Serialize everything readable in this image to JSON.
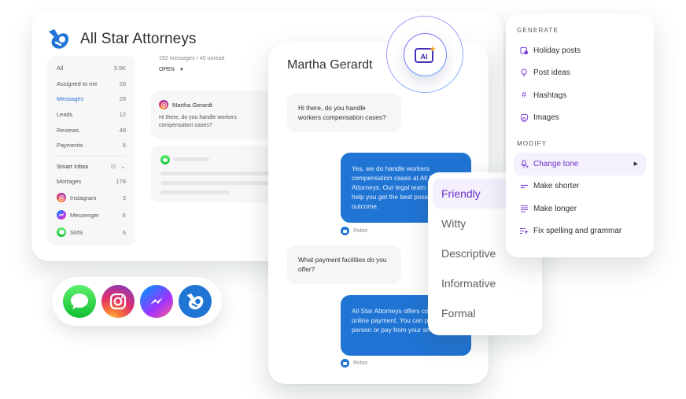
{
  "app": {
    "title": "All Star Attorneys",
    "brand_color": "#1f74d4",
    "accent_color": "#6a33c8"
  },
  "sidebar": {
    "items": [
      {
        "label": "All",
        "count": "3.5K",
        "active": false
      },
      {
        "label": "Assigned to me",
        "count": "28",
        "active": false
      },
      {
        "label": "Messages",
        "count": "28",
        "active": true
      },
      {
        "label": "Leads",
        "count": "12",
        "active": false
      },
      {
        "label": "Reviews",
        "count": "48",
        "active": false
      },
      {
        "label": "Payments",
        "count": "6",
        "active": false
      }
    ],
    "smart_inbox": {
      "label": "Smart Inbox",
      "items": [
        {
          "label": "Mortages",
          "count": "178",
          "icon": "none"
        },
        {
          "label": "Instagram",
          "count": "3",
          "icon": "instagram-icon"
        },
        {
          "label": "Messenger",
          "count": "6",
          "icon": "messenger-icon"
        },
        {
          "label": "SMS",
          "count": "6",
          "icon": "sms-icon"
        }
      ]
    }
  },
  "inbox": {
    "meta": "192 messages • 45 unread",
    "filter": "OPEN",
    "filter_caret": "▼",
    "conversations": [
      {
        "name": "Martha Gerardt",
        "channel": "instagram",
        "preview": "Hi there, do you handle workers compensation cases?"
      }
    ]
  },
  "chat": {
    "contact_name": "Martha Gerardt",
    "messages": [
      {
        "direction": "in",
        "text": "Hi there, do you handle workers compensation cases?"
      },
      {
        "direction": "out",
        "text": "Yes, we do handle workers compensation cases at All Star Attorneys. Our legal team is eager to help you get the best possible outcome.",
        "author": "Robin"
      },
      {
        "direction": "in",
        "text": "What payment facilities do you offer?"
      },
      {
        "direction": "out",
        "text": "All Star Attorneys offers convenient online payment. You can pay in person or pay from your smartphone.",
        "author": "Robin"
      }
    ]
  },
  "ai_badge": {
    "label": "AI"
  },
  "tone_menu": {
    "items": [
      {
        "label": "Friendly",
        "selected": true
      },
      {
        "label": "Witty",
        "selected": false
      },
      {
        "label": "Descriptive",
        "selected": false
      },
      {
        "label": "Informative",
        "selected": false
      },
      {
        "label": "Formal",
        "selected": false
      }
    ]
  },
  "ai_menu": {
    "generate_heading": "GENERATE",
    "generate_items": [
      {
        "label": "Holiday posts",
        "icon": "calendar-icon"
      },
      {
        "label": "Post ideas",
        "icon": "lightbulb-icon"
      },
      {
        "label": "Hashtags",
        "icon": "hashtag-icon"
      },
      {
        "label": "Images",
        "icon": "image-icon"
      }
    ],
    "modify_heading": "MODIFY",
    "modify_items": [
      {
        "label": "Change tone",
        "icon": "tone-icon",
        "active": true,
        "has_submenu": true
      },
      {
        "label": "Make shorter",
        "icon": "short-lines-icon"
      },
      {
        "label": "Make longer",
        "icon": "long-lines-icon"
      },
      {
        "label": "Fix spelling and grammar",
        "icon": "spellcheck-icon"
      }
    ]
  },
  "channels": [
    {
      "name": "SMS",
      "icon": "sms-icon"
    },
    {
      "name": "Instagram",
      "icon": "instagram-icon"
    },
    {
      "name": "Messenger",
      "icon": "messenger-icon"
    },
    {
      "name": "All Star Attorneys",
      "icon": "brand-logo-icon"
    }
  ]
}
